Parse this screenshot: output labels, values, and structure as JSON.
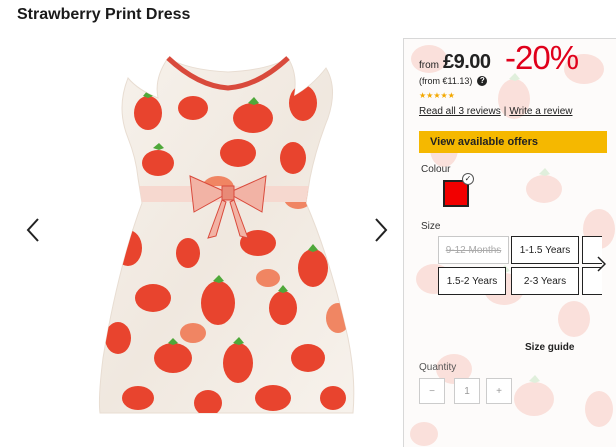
{
  "product": {
    "title": "Strawberry Print Dress"
  },
  "gallery": {
    "prev_icon": "chevron-left-icon",
    "next_icon": "chevron-right-icon"
  },
  "pricing": {
    "from_label": "from",
    "price": "£9.00",
    "discount": "-20%",
    "eur_price": "(from €11.13)",
    "help_icon": "?"
  },
  "rating": {
    "stars_display": "★★★★★",
    "stars": 5,
    "read_reviews": "Read all 3 reviews",
    "separator": "|",
    "write_review": "Write a review"
  },
  "offers": {
    "label": "View available offers"
  },
  "colour": {
    "label": "Colour",
    "selected_color": "#f20000",
    "check": "✓"
  },
  "size": {
    "label": "Size",
    "options": [
      {
        "label": "9-12 Months",
        "available": false
      },
      {
        "label": "1-1.5 Years",
        "available": true
      },
      {
        "label": "1.5-2 Years",
        "available": true
      },
      {
        "label": "2-3 Years",
        "available": true
      }
    ],
    "guide_label": "Size guide"
  },
  "quantity": {
    "label": "Quantity",
    "decrement": "−",
    "value": "1",
    "increment": "+"
  },
  "colors": {
    "accent_yellow": "#f5b800",
    "discount_red": "#e0001b",
    "stars": "#f3a800"
  }
}
